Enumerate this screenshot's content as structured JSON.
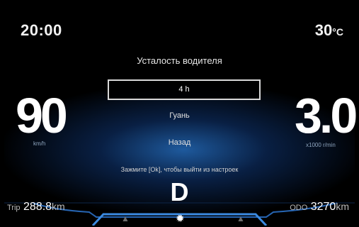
{
  "status": {
    "time": "20:00",
    "temperature": "30",
    "temperature_unit": "°C"
  },
  "menu": {
    "title": "Усталость водителя",
    "selected": "4 h",
    "items": [
      "Гуань",
      "Назад"
    ],
    "hint": "Зажмите [Ok], чтобы выйти из настроек"
  },
  "speed": {
    "value": "90",
    "unit": "km/h"
  },
  "rpm": {
    "value": "3.0",
    "unit": "x1000 r/min"
  },
  "gear": "D",
  "trip": {
    "label": "Trip",
    "value": "288.8",
    "unit": "km"
  },
  "odo": {
    "label": "ODO",
    "value": "3270",
    "unit": "km"
  },
  "icons": {
    "left_warning": "warning-triangle-icon",
    "center": "settings-gear-icon",
    "right_warning": "warning-triangle-icon"
  },
  "colors": {
    "accent_blue": "#2f7fd6",
    "background": "#000000"
  }
}
